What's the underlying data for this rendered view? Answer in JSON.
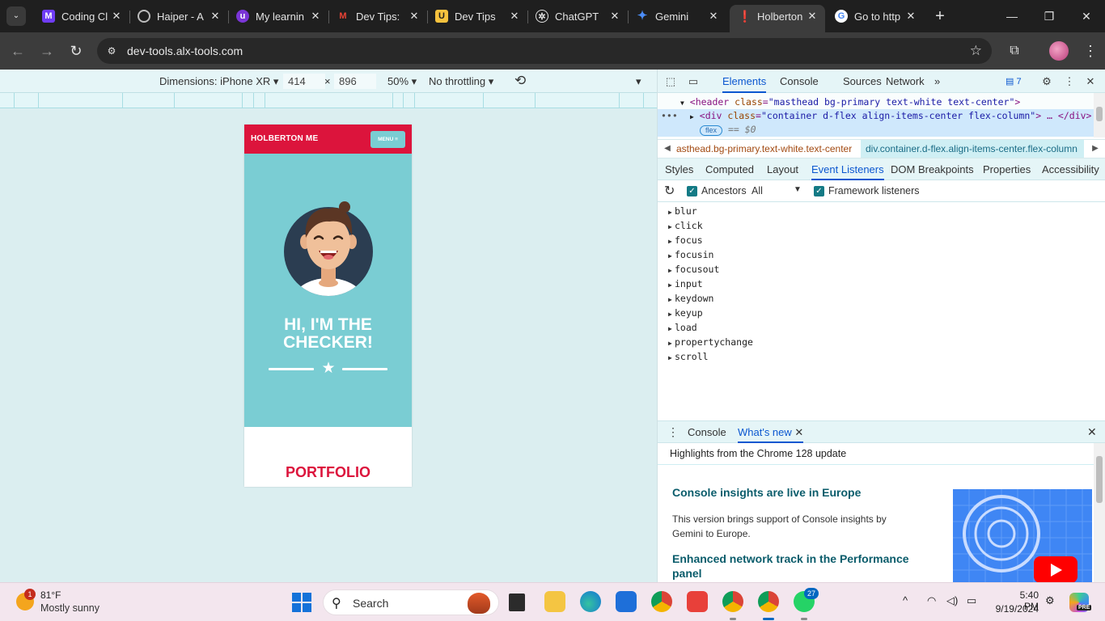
{
  "browser": {
    "tabs": [
      {
        "title": "Coding Cl",
        "icon": "coding-logo-icon",
        "color": "#6f3cf5"
      },
      {
        "title": "Haiper - A",
        "icon": "haiper-ring-icon",
        "color": "#9a9a9a"
      },
      {
        "title": "My learnin",
        "icon": "udemy-u-icon",
        "color": "#7a35d7"
      },
      {
        "title": "Dev Tips:",
        "icon": "gmail-icon",
        "color": "#ea4335"
      },
      {
        "title": "Dev Tips",
        "icon": "u-logo-icon",
        "color": "#f6c23e"
      },
      {
        "title": "ChatGPT",
        "icon": "chatgpt-icon",
        "color": "#e3e3e3"
      },
      {
        "title": "Gemini",
        "icon": "gemini-sparkle-icon",
        "color": "#4b8df8"
      },
      {
        "title": "Holberton",
        "icon": "holberton-icon",
        "color": "#e0173d",
        "active": true
      },
      {
        "title": "Go to http",
        "icon": "google-g-icon",
        "color": "#4285f4"
      }
    ],
    "url": "dev-tools.alx-tools.com"
  },
  "device_toolbar": {
    "dimensions_label": "Dimensions: iPhone XR",
    "width": "414",
    "height": "896",
    "times": "×",
    "zoom": "50%",
    "throttling": "No throttling"
  },
  "emulated_page": {
    "brand": "HOLBERTON ME",
    "menu_button": "MENU ≡",
    "heading": "HI, I'M THE CHECKER!",
    "section_title": "PORTFOLIO",
    "colors": {
      "primary": "#dc143c",
      "secondary": "#7acdd3"
    }
  },
  "devtools": {
    "tabs": [
      "Elements",
      "Console",
      "Sources",
      "Network"
    ],
    "active_tab": "Elements",
    "more_tabs": "»",
    "issues_count": "7",
    "dom": {
      "line1_tag": "<header",
      "line1_attr": "class",
      "line1_val": "\"masthead bg-primary text-white text-center\"",
      "line1_end": ">",
      "line2_tag": "<div",
      "line2_attr": "class",
      "line2_val": "\"container d-flex align-items-center flex-column\"",
      "line2_end": "> … </div>",
      "badge": "flex",
      "dollar": "== $0"
    },
    "breadcrumbs": [
      "asthead.bg-primary.text-white.text-center",
      "div.container.d-flex.align-items-center.flex-column"
    ],
    "subtabs": [
      "Styles",
      "Computed",
      "Layout",
      "Event Listeners",
      "DOM Breakpoints",
      "Properties",
      "Accessibility"
    ],
    "active_subtab": "Event Listeners",
    "listener_toolbar": {
      "ancestors_label": "Ancestors",
      "ancestors_select": "All",
      "framework_label": "Framework listeners"
    },
    "event_listeners": [
      "blur",
      "click",
      "focus",
      "focusin",
      "focusout",
      "input",
      "keydown",
      "keyup",
      "load",
      "propertychange",
      "scroll"
    ],
    "drawer": {
      "tabs": [
        "Console",
        "What's new"
      ],
      "active": "What's new",
      "highlights": "Highlights from the Chrome 128 update",
      "items": [
        {
          "heading": "Console insights are live in Europe",
          "body": "This version brings support of Console insights by Gemini to Europe."
        },
        {
          "heading": "Enhanced network track in the Performance panel",
          "body": ""
        }
      ]
    }
  },
  "taskbar": {
    "weather_badge": "1",
    "temperature": "81°F",
    "weather_desc": "Mostly sunny",
    "search_placeholder": "Search",
    "whatsapp_badge": "27",
    "time": "5:40 PM",
    "date": "9/19/2024",
    "copilot_badge": "PRE"
  }
}
